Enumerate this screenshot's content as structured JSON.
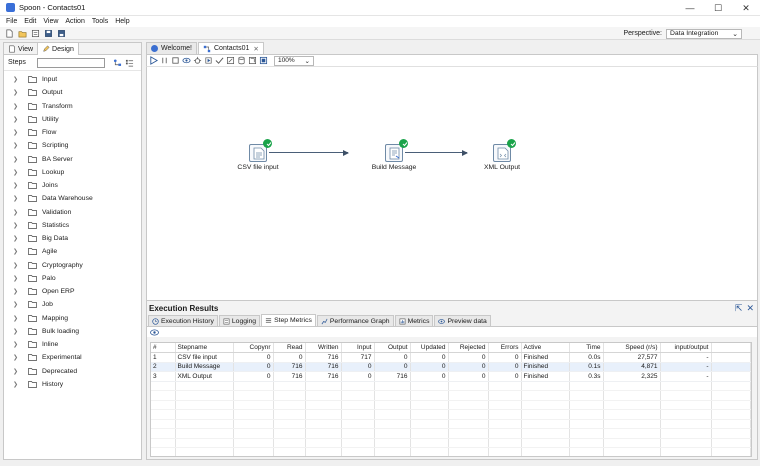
{
  "window": {
    "title": "Spoon - Contacts01",
    "minimize": "—",
    "maximize": "☐",
    "close": "✕"
  },
  "menu": [
    "File",
    "Edit",
    "View",
    "Action",
    "Tools",
    "Help"
  ],
  "perspective": {
    "label": "Perspective:",
    "value": "Data Integration"
  },
  "left_panel": {
    "tabs": [
      "View",
      "Design"
    ],
    "steps_label": "Steps",
    "tree": [
      "Input",
      "Output",
      "Transform",
      "Utility",
      "Flow",
      "Scripting",
      "BA Server",
      "Lookup",
      "Joins",
      "Data Warehouse",
      "Validation",
      "Statistics",
      "Big Data",
      "Agile",
      "Cryptography",
      "Palo",
      "Open ERP",
      "Job",
      "Mapping",
      "Bulk loading",
      "Inline",
      "Experimental",
      "Deprecated",
      "History"
    ]
  },
  "editor": {
    "tabs": [
      "Welcome!",
      "Contacts01"
    ],
    "zoom": "100%"
  },
  "nodes": [
    "CSV file input",
    "Build Message",
    "XML Output"
  ],
  "execution": {
    "title": "Execution Results",
    "tabs": [
      "Execution History",
      "Logging",
      "Step Metrics",
      "Performance Graph",
      "Metrics",
      "Preview data"
    ],
    "columns": [
      "#",
      "Stepname",
      "Copynr",
      "Read",
      "Written",
      "Input",
      "Output",
      "Updated",
      "Rejected",
      "Errors",
      "Active",
      "Time",
      "Speed (r/s)",
      "input/output"
    ],
    "rows": [
      [
        "1",
        "CSV file input",
        "0",
        "0",
        "716",
        "717",
        "0",
        "0",
        "0",
        "0",
        "Finished",
        "0.0s",
        "27,577",
        "-"
      ],
      [
        "2",
        "Build Message",
        "0",
        "716",
        "716",
        "0",
        "0",
        "0",
        "0",
        "0",
        "Finished",
        "0.1s",
        "4,871",
        "-"
      ],
      [
        "3",
        "XML Output",
        "0",
        "716",
        "716",
        "0",
        "716",
        "0",
        "0",
        "0",
        "Finished",
        "0.3s",
        "2,325",
        "-"
      ]
    ]
  },
  "colors": {
    "accent": "#3b6fd1",
    "ok": "#1aa34a",
    "hop": "#4a5e78"
  }
}
